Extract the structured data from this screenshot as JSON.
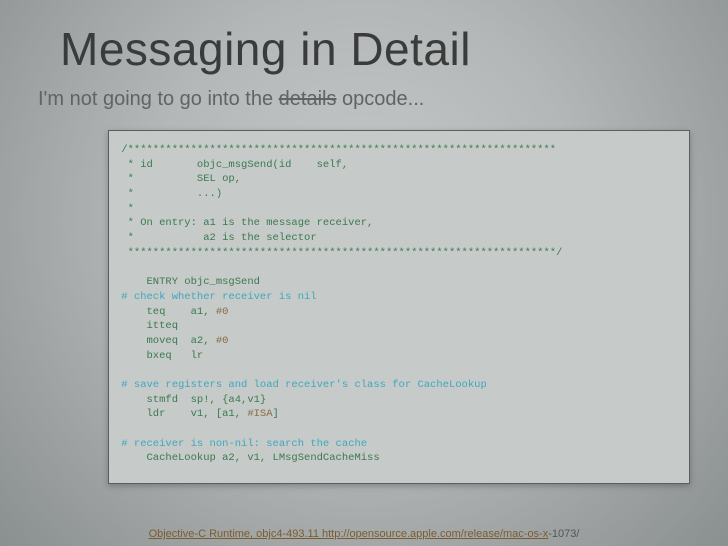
{
  "title": "Messaging in Detail",
  "subtitle_pre": "I'm not going to go into the ",
  "subtitle_strike": "details",
  "subtitle_post": " opcode...",
  "code": {
    "c01": " /********************************************************************",
    "c02": "  * id       objc_msgSend(id    self,",
    "c03": "  *          SEL op,",
    "c04": "  *          ...)",
    "c05": "  *",
    "c06": "  * On entry: a1 is the message receiver,",
    "c07": "  *           a2 is the selector",
    "c08": "  ********************************************************************/",
    "c09": " ",
    "c10": "     ENTRY objc_msgSend",
    "c11a": " # check whether receiver is nil",
    "c12a": "     teq    a1, ",
    "c12b": "#0",
    "c13": "     itteq",
    "c14a": "     moveq  a2, ",
    "c14b": "#0",
    "c15": "     bxeq   lr",
    "c16": " ",
    "c17a": " # save registers and load receiver's class for CacheLookup",
    "c18": "     stmfd  sp!, {a4,v1}",
    "c19a": "     ldr    v1, [a1, ",
    "c19b": "#ISA",
    "c19c": "]",
    "c20": " ",
    "c21a": " # receiver is non-nil: search the cache",
    "c22": "     CacheLookup a2, v1, LMsgSendCacheMiss"
  },
  "footer_link": "Objective-C Runtime, objc4-493.11 http://opensource.apple.com/release/mac-os-x",
  "footer_tail": "-1073/"
}
